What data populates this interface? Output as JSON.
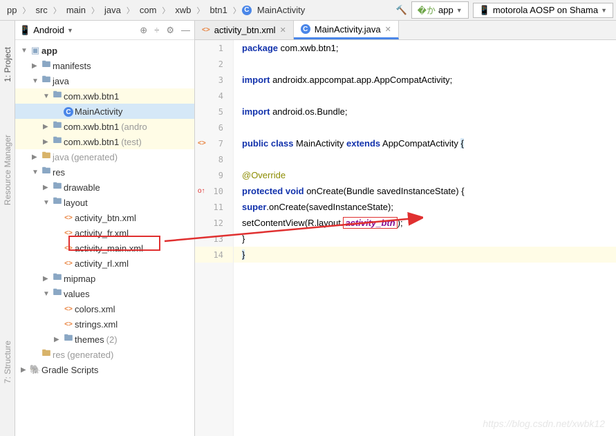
{
  "breadcrumbs": [
    "pp",
    "src",
    "main",
    "java",
    "com",
    "xwb",
    "btn1",
    "MainActivity"
  ],
  "toolbar": {
    "config": "app",
    "device": "motorola AOSP on Shama"
  },
  "sideTabs": {
    "project": "1: Project",
    "resmgr": "Resource Manager",
    "structure": "7: Structure"
  },
  "panel": {
    "title": "Android"
  },
  "tree": {
    "app": "app",
    "manifests": "manifests",
    "java": "java",
    "pkg": "com.xwb.btn1",
    "mainActivity": "MainActivity",
    "pkgAndroid": "com.xwb.btn1",
    "pkgAndroidSuffix": "(andro",
    "pkgTest": "com.xwb.btn1",
    "pkgTestSuffix": "(test)",
    "javaGen": "java",
    "javaGenSuffix": "(generated)",
    "res": "res",
    "drawable": "drawable",
    "layout": "layout",
    "layout_files": [
      "activity_btn.xml",
      "activity_fr.xml",
      "activity_main.xml",
      "activity_rl.xml"
    ],
    "mipmap": "mipmap",
    "values": "values",
    "values_files": [
      "colors.xml",
      "strings.xml"
    ],
    "themes": "themes",
    "themesSuffix": "(2)",
    "resGen": "res",
    "resGenSuffix": "(generated)",
    "gradle": "Gradle Scripts"
  },
  "tabs": [
    {
      "icon": "xml",
      "label": "activity_btn.xml",
      "active": false
    },
    {
      "icon": "class",
      "label": "MainActivity.java",
      "active": true
    }
  ],
  "code": {
    "l1_a": "package",
    "l1_b": " com.xwb.btn1;",
    "l3_a": "import",
    "l3_b": " androidx.appcompat.app.AppCompatActivity;",
    "l5_a": "import",
    "l5_b": " android.os.Bundle;",
    "l7_a": "public class",
    "l7_b": " MainActivity ",
    "l7_c": "extends",
    "l7_d": " AppCompatActivity ",
    "l7_e": "{",
    "l9": "@Override",
    "l10_a": "protected void",
    "l10_b": " onCreate(Bundle savedInstanceState) {",
    "l11_a": "super",
    "l11_b": ".onCreate(savedInstanceState);",
    "l12_a": "setContentView(R.layout.",
    "l12_b": "activity_btn",
    "l12_c": ");",
    "l13": "}",
    "l14": "}"
  },
  "watermark": "https://blog.csdn.net/xwbk12"
}
